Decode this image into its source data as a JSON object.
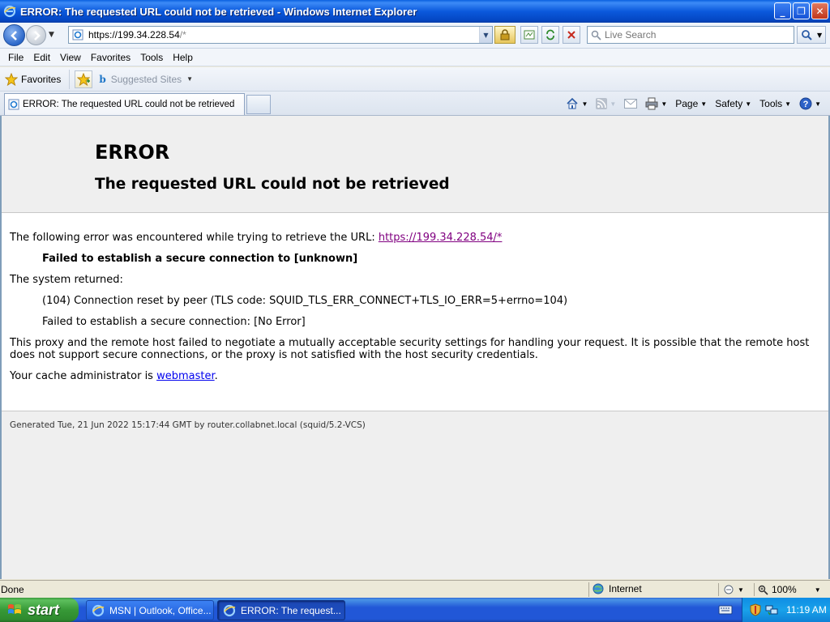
{
  "window": {
    "title": "ERROR: The requested URL could not be retrieved - Windows Internet Explorer",
    "min_label": "_",
    "max_label": "❐",
    "close_label": "✕"
  },
  "address": {
    "url_main": "https://199.34.228.54",
    "url_path": "/*"
  },
  "search": {
    "placeholder": "Live Search"
  },
  "menu": {
    "items": [
      "File",
      "Edit",
      "View",
      "Favorites",
      "Tools",
      "Help"
    ]
  },
  "favorites_bar": {
    "favorites_label": "Favorites",
    "suggested_label": "Suggested Sites"
  },
  "tab": {
    "title": "ERROR: The requested URL could not be retrieved"
  },
  "command_bar": {
    "page_label": "Page",
    "safety_label": "Safety",
    "tools_label": "Tools"
  },
  "page": {
    "heading": "ERROR",
    "subheading": "The requested URL could not be retrieved",
    "intro_text": "The following error was encountered while trying to retrieve the URL: ",
    "intro_link": "https://199.34.228.54/*",
    "error_bold": "Failed to establish a secure connection to [unknown]",
    "system_returned": "The system returned:",
    "system_detail": "(104) Connection reset by peer (TLS code: SQUID_TLS_ERR_CONNECT+TLS_IO_ERR=5+errno=104)",
    "secure_detail": "Failed to establish a secure connection: [No Error]",
    "explanation": "This proxy and the remote host failed to negotiate a mutually acceptable security settings for handling your request. It is possible that the remote host does not support secure connections, or the proxy is not satisfied with the host security credentials.",
    "admin_text": "Your cache administrator is ",
    "admin_link": "webmaster",
    "admin_suffix": ".",
    "generated": "Generated Tue, 21 Jun 2022 15:17:44 GMT by router.collabnet.local (squid/5.2-VCS)"
  },
  "status_bar": {
    "status": "Done",
    "zone": "Internet",
    "zoom": "100%"
  },
  "taskbar": {
    "start_label": "start",
    "items": [
      {
        "label": "MSN | Outlook, Office..."
      },
      {
        "label": "ERROR: The request..."
      }
    ],
    "clock": "11:19 AM"
  },
  "colors": {
    "title_bar": "#0B59DC",
    "link_visited": "#800080",
    "link": "#0000EE",
    "error_header_bg": "#EFEFEF",
    "taskbar": "#2157D7",
    "start_button": "#379937"
  }
}
